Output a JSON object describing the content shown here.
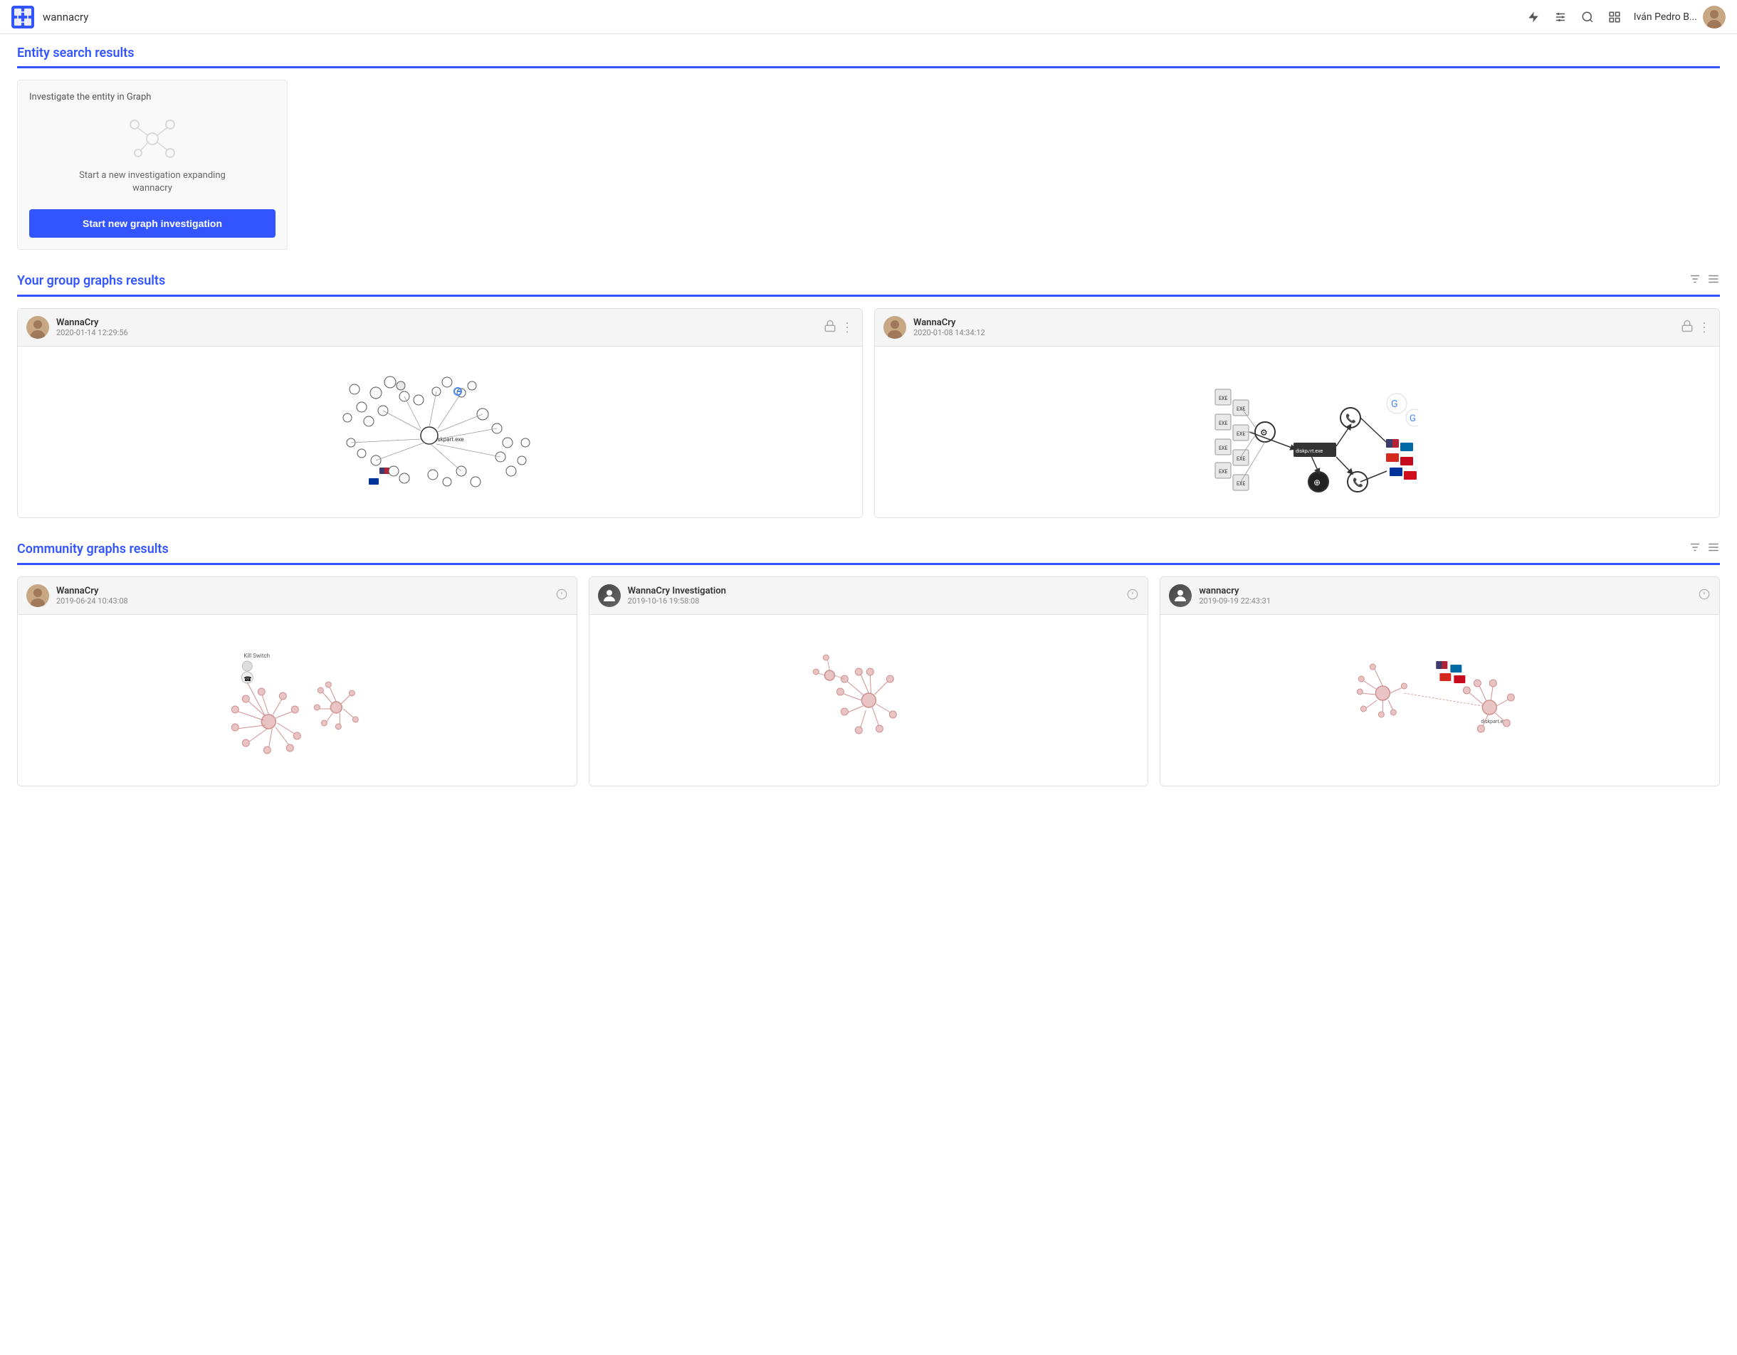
{
  "header": {
    "search_query": "wannacry",
    "user_name": "Iván Pedro B...",
    "icons": [
      "bolt",
      "sliders",
      "search",
      "grid"
    ]
  },
  "entity_section": {
    "title": "Entity search results",
    "panel": {
      "label": "Investigate the entity in Graph",
      "description_line1": "Start a new investigation expanding",
      "description_line2": "wannacry",
      "button_label": "Start new graph investigation"
    }
  },
  "group_graphs": {
    "title": "Your group graphs results",
    "cards": [
      {
        "name": "WannaCry",
        "date": "2020-01-14 12:29:56",
        "avatar_type": "person"
      },
      {
        "name": "WannaCry",
        "date": "2020-01-08 14:34:12",
        "avatar_type": "person"
      }
    ]
  },
  "community_graphs": {
    "title": "Community graphs results",
    "cards": [
      {
        "name": "WannaCry",
        "date": "2019-06-24 10:43:08",
        "avatar_type": "person"
      },
      {
        "name": "WannaCry Investigation",
        "date": "2019-10-16 19:58:08",
        "avatar_type": "anon"
      },
      {
        "name": "wannacry",
        "date": "2019-09-19 22:43:31",
        "avatar_type": "anon"
      }
    ]
  }
}
